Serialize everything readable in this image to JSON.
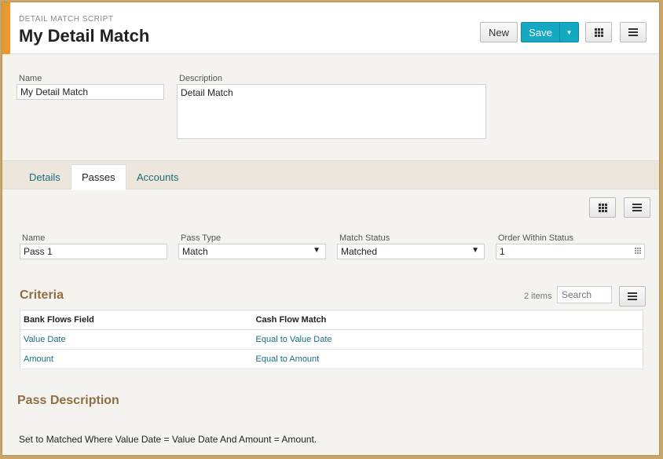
{
  "header": {
    "eyebrow": "DETAIL MATCH SCRIPT",
    "title": "My Detail Match",
    "new_label": "New",
    "save_label": "Save"
  },
  "form": {
    "name_label": "Name",
    "name_value": "My Detail Match",
    "description_label": "Description",
    "description_value": "Detail Match"
  },
  "tabs": [
    {
      "label": "Details"
    },
    {
      "label": "Passes"
    },
    {
      "label": "Accounts"
    }
  ],
  "pass": {
    "name_label": "Name",
    "name_value": "Pass 1",
    "pass_type_label": "Pass Type",
    "pass_type_value": "Match",
    "match_status_label": "Match Status",
    "match_status_value": "Matched",
    "order_label": "Order Within Status",
    "order_value": "1"
  },
  "criteria": {
    "title": "Criteria",
    "count": "2 items",
    "search_placeholder": "Search",
    "columns": [
      "Bank Flows Field",
      "Cash Flow Match"
    ],
    "rows": [
      [
        "Value Date",
        "Equal to Value Date"
      ],
      [
        "Amount",
        "Equal to Amount"
      ]
    ]
  },
  "pass_description": {
    "title": "Pass Description",
    "text": "Set to Matched Where Value Date = Value Date And Amount = Amount."
  },
  "colors": {
    "accent": "#ea9a2d",
    "primary": "#14a8c2",
    "link": "#1b6d7f",
    "section": "#8e6f45"
  }
}
